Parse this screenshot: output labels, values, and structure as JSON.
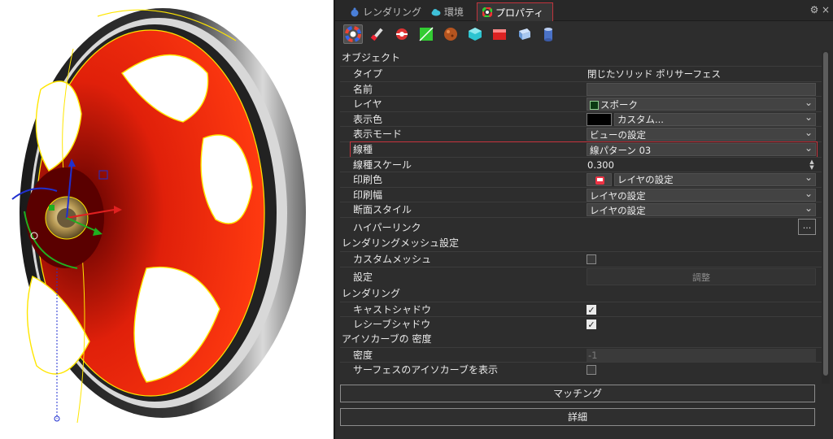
{
  "tabs": [
    {
      "label": "レンダリング",
      "icon": "teapot-icon"
    },
    {
      "label": "環境",
      "icon": "cloud-icon"
    },
    {
      "label": "プロパティ",
      "icon": "color-wheel-icon",
      "active": true
    }
  ],
  "panel_icons": [
    "object-properties-icon",
    "material-brush-icon",
    "decal-icon",
    "texture-mapping-icon",
    "displacement-sphere-icon",
    "shutlining-cube-icon",
    "edge-softening-icon",
    "thickening-icon",
    "curve-piping-icon"
  ],
  "sections": {
    "object": "オブジェクト",
    "render_mesh": "レンダリングメッシュ設定",
    "rendering": "レンダリング",
    "isocurve": "アイソカーブの 密度"
  },
  "object": {
    "type_label": "タイプ",
    "type_value": "閉じたソリッド ポリサーフェス",
    "name_label": "名前",
    "name_value": "",
    "layer_label": "レイヤ",
    "layer_value": "スポーク",
    "display_color_label": "表示色",
    "display_color_value": "カスタム...",
    "display_mode_label": "表示モード",
    "display_mode_value": "ビューの設定",
    "linetype_label": "線種",
    "linetype_value": "線パターン 03",
    "linetype_scale_label": "線種スケール",
    "linetype_scale_value": "0.300",
    "print_color_label": "印刷色",
    "print_color_value": "レイヤの設定",
    "print_width_label": "印刷幅",
    "print_width_value": "レイヤの設定",
    "section_style_label": "断面スタイル",
    "section_style_value": "レイヤの設定",
    "hyperlink_label": "ハイパーリンク",
    "hyperlink_button": "..."
  },
  "render_mesh": {
    "custom_mesh_label": "カスタムメッシュ",
    "custom_mesh_checked": false,
    "settings_label": "設定",
    "adjust_button": "調整"
  },
  "rendering": {
    "cast_shadows_label": "キャストシャドウ",
    "cast_shadows_checked": true,
    "receive_shadows_label": "レシーブシャドウ",
    "receive_shadows_checked": true
  },
  "isocurve": {
    "density_label": "密度",
    "density_value": "-1",
    "show_label": "サーフェスのアイソカーブを表示",
    "show_checked": false
  },
  "buttons": {
    "match": "マッチング",
    "details": "詳細"
  },
  "colors": {
    "layer_swatch": "#0b3a12",
    "display_swatch": "#000000",
    "highlight": "#c7343d",
    "wheel_red": "#e0200a",
    "selection_yellow": "#ffe600"
  }
}
